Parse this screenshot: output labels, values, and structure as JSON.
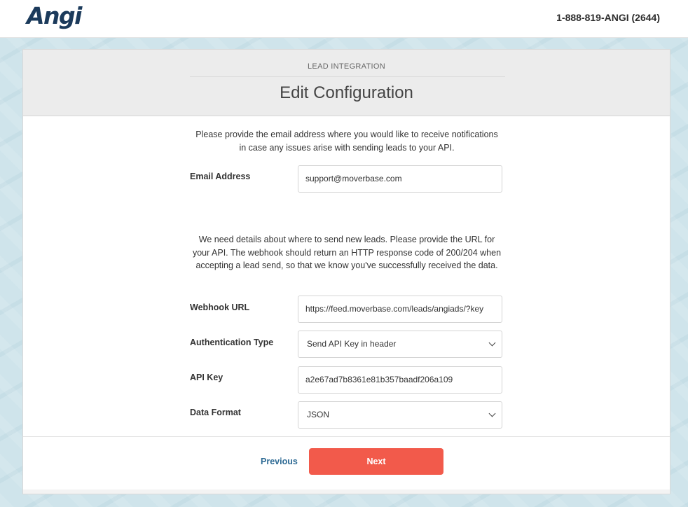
{
  "header": {
    "logo_text": "Angi",
    "phone": "1-888-819-ANGI (2644)"
  },
  "card": {
    "eyebrow": "LEAD INTEGRATION",
    "title": "Edit Configuration",
    "intro_email": "Please provide the email address where you would like to receive notifications in case any issues arise with sending leads to your API.",
    "intro_webhook": "We need details about where to send new leads. Please provide the URL for your API. The webhook should return an HTTP response code of 200/204 when accepting a lead send, so that we know you've successfully received the data."
  },
  "fields": {
    "email": {
      "label": "Email Address",
      "value": "support@moverbase.com"
    },
    "webhook": {
      "label": "Webhook URL",
      "value": "https://feed.moverbase.com/leads/angiads/?key"
    },
    "auth_type": {
      "label": "Authentication Type",
      "value": "Send API Key in header"
    },
    "api_key": {
      "label": "API Key",
      "value": "a2e67ad7b8361e81b357baadf206a109"
    },
    "data_format": {
      "label": "Data Format",
      "value": "JSON"
    }
  },
  "actions": {
    "previous": "Previous",
    "next": "Next"
  },
  "colors": {
    "brand": "#1b3a5b",
    "primary_button": "#f25a4b",
    "link": "#2d6a94",
    "background": "#cfe4eb"
  }
}
